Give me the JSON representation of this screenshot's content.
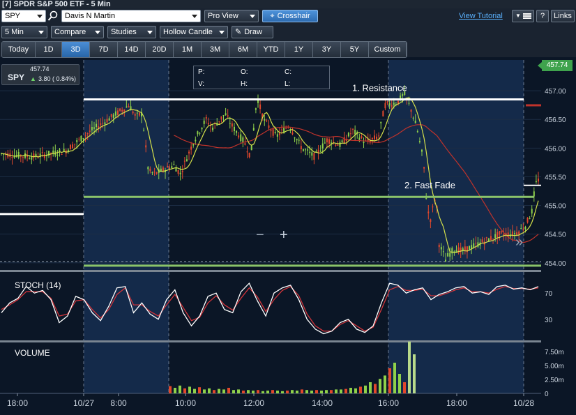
{
  "window_title": "[7] SPDR S&P 500 ETF - 5 Min",
  "toolbar": {
    "symbol": "SPY",
    "account": "Davis N Martin",
    "view": "Pro View",
    "crosshair": "Crosshair",
    "view_tutorial": "View Tutorial",
    "help": "?",
    "links": "Links",
    "interval": "5 Min",
    "compare": "Compare",
    "studies": "Studies",
    "chart_style": "Hollow Candle",
    "draw": "Draw"
  },
  "ranges": [
    "Today",
    "1D",
    "3D",
    "7D",
    "14D",
    "20D",
    "1M",
    "3M",
    "6M",
    "YTD",
    "1Y",
    "3Y",
    "5Y",
    "Custom"
  ],
  "active_range": "3D",
  "quote": {
    "symbol": "SPY",
    "last": "457.74",
    "change": "3.80 ( 0.84%)"
  },
  "ohlc_labels": {
    "p": "P:",
    "o": "O:",
    "c": "C:",
    "v": "V:",
    "h": "H:",
    "l": "L:"
  },
  "last_price_tag": "457.74",
  "colors": {
    "bg_regular": "#0b1626",
    "bg_extended": "#142a4a",
    "up": "#8fd14a",
    "down": "#e2482c",
    "ma_fast": "#d6e24a",
    "ma_slow": "#c0332b",
    "stoch_k": "#ffffff",
    "stoch_d": "#d2343a",
    "resistance": "#ffffff",
    "support": "#8bc46a",
    "price_tag": "#3fa34d"
  },
  "chart_data": [
    {
      "type": "candlestick",
      "panel": "price",
      "y_ticks": [
        "457.00",
        "456.50",
        "456.00",
        "455.50",
        "455.00",
        "454.50",
        "454.00"
      ],
      "ylim": [
        453.9,
        457.5
      ],
      "x_ticks": [
        "18:00",
        "10/27",
        "8:00",
        "10:00",
        "12:00",
        "14:00",
        "16:00",
        "18:00",
        "10/28"
      ],
      "close_path": [
        [
          0,
          455.9
        ],
        [
          5,
          455.85
        ],
        [
          10,
          455.95
        ],
        [
          14,
          456.3
        ],
        [
          18,
          456.6
        ],
        [
          20,
          456.75
        ],
        [
          21,
          456.55
        ],
        [
          22,
          456.6
        ],
        [
          23,
          455.6
        ],
        [
          24,
          455.55
        ],
        [
          27,
          455.7
        ],
        [
          28,
          455.55
        ],
        [
          30,
          456.1
        ],
        [
          32,
          456.5
        ],
        [
          33,
          456.35
        ],
        [
          35,
          456.6
        ],
        [
          36,
          456.4
        ],
        [
          38,
          456.1
        ],
        [
          39,
          455.85
        ],
        [
          40,
          456.9
        ],
        [
          41,
          456.5
        ],
        [
          43,
          456.2
        ],
        [
          45,
          456.4
        ],
        [
          47,
          456.0
        ],
        [
          49,
          455.85
        ],
        [
          51,
          456.15
        ],
        [
          53,
          456.05
        ],
        [
          55,
          456.3
        ],
        [
          57,
          456.1
        ],
        [
          59,
          456.2
        ],
        [
          60,
          456.75
        ],
        [
          62,
          456.8
        ],
        [
          63,
          456.95
        ],
        [
          64,
          456.7
        ],
        [
          65,
          456.35
        ],
        [
          66,
          455.8
        ],
        [
          66.5,
          455.1
        ],
        [
          67,
          454.7
        ],
        [
          68,
          455.2
        ],
        [
          68.5,
          454.3
        ],
        [
          69,
          454.2
        ],
        [
          69.5,
          454.05
        ],
        [
          70,
          454.15
        ],
        [
          71,
          454.25
        ],
        [
          72,
          454.2
        ],
        [
          73,
          454.25
        ],
        [
          75,
          454.35
        ],
        [
          77,
          454.45
        ],
        [
          78,
          454.5
        ],
        [
          80,
          454.5
        ],
        [
          81,
          454.55
        ],
        [
          82,
          454.65
        ],
        [
          83,
          454.9
        ],
        [
          83.5,
          455.35
        ],
        [
          84,
          455.45
        ]
      ],
      "annotations": [
        {
          "text": "1. Resistance",
          "price": 456.85
        },
        {
          "text": "2. Fast Fade",
          "price": 455.15
        }
      ],
      "levels": [
        {
          "kind": "resistance",
          "price": 456.85
        },
        {
          "kind": "support",
          "price": 455.15
        },
        {
          "kind": "support",
          "price": 453.95
        },
        {
          "kind": "prior-close",
          "price": 454.85
        }
      ]
    },
    {
      "type": "line",
      "panel": "oscillator",
      "title": "STOCH (14)",
      "y_ticks": [
        "70",
        "30"
      ],
      "ylim": [
        0,
        100
      ],
      "series": [
        {
          "values": [
            40,
            55,
            62,
            80,
            70,
            74,
            60,
            25,
            35,
            65,
            60,
            40,
            28,
            50,
            78,
            80,
            40,
            55,
            38,
            30,
            60,
            75,
            40,
            20,
            35,
            65,
            70,
            45,
            40,
            72,
            85,
            58,
            35,
            70,
            78,
            82,
            60,
            30,
            15,
            8,
            12,
            25,
            30,
            15,
            10,
            20,
            55,
            85,
            82,
            70,
            75,
            78,
            60,
            68,
            72,
            78,
            80,
            70,
            72,
            68,
            80,
            82,
            76,
            78,
            75,
            80
          ]
        },
        {
          "values": [
            45,
            52,
            60,
            72,
            72,
            72,
            62,
            35,
            38,
            58,
            60,
            45,
            32,
            45,
            68,
            78,
            52,
            52,
            42,
            35,
            52,
            68,
            48,
            28,
            33,
            55,
            66,
            52,
            44,
            62,
            78,
            64,
            42,
            60,
            74,
            80,
            66,
            38,
            20,
            12,
            12,
            22,
            28,
            20,
            12,
            18,
            45,
            75,
            80,
            74,
            74,
            76,
            66,
            66,
            70,
            75,
            78,
            72,
            72,
            70,
            76,
            80,
            77,
            77,
            76,
            78
          ]
        }
      ]
    },
    {
      "type": "bar",
      "panel": "volume",
      "title": "VOLUME",
      "y_ticks": [
        "7.50m",
        "5.00m",
        "2.50m",
        "0"
      ],
      "ylim": [
        0,
        9
      ],
      "values": [
        1.3,
        1.0,
        1.4,
        0.9,
        1.2,
        0.8,
        1.1,
        0.7,
        0.9,
        0.6,
        0.8,
        0.7,
        1.0,
        0.6,
        0.7,
        0.5,
        0.6,
        0.5,
        0.6,
        0.4,
        0.5,
        0.6,
        0.5,
        0.4,
        0.5,
        0.6,
        0.5,
        0.7,
        0.6,
        0.5,
        0.6,
        0.5,
        0.6,
        0.6,
        0.7,
        0.7,
        0.8,
        1.0,
        0.9,
        1.2,
        1.4,
        2.0,
        1.7,
        2.6,
        3.2,
        4.5,
        5.5,
        3.5,
        2.0,
        9.3,
        7.0
      ],
      "series_colors_from_price": true
    }
  ]
}
